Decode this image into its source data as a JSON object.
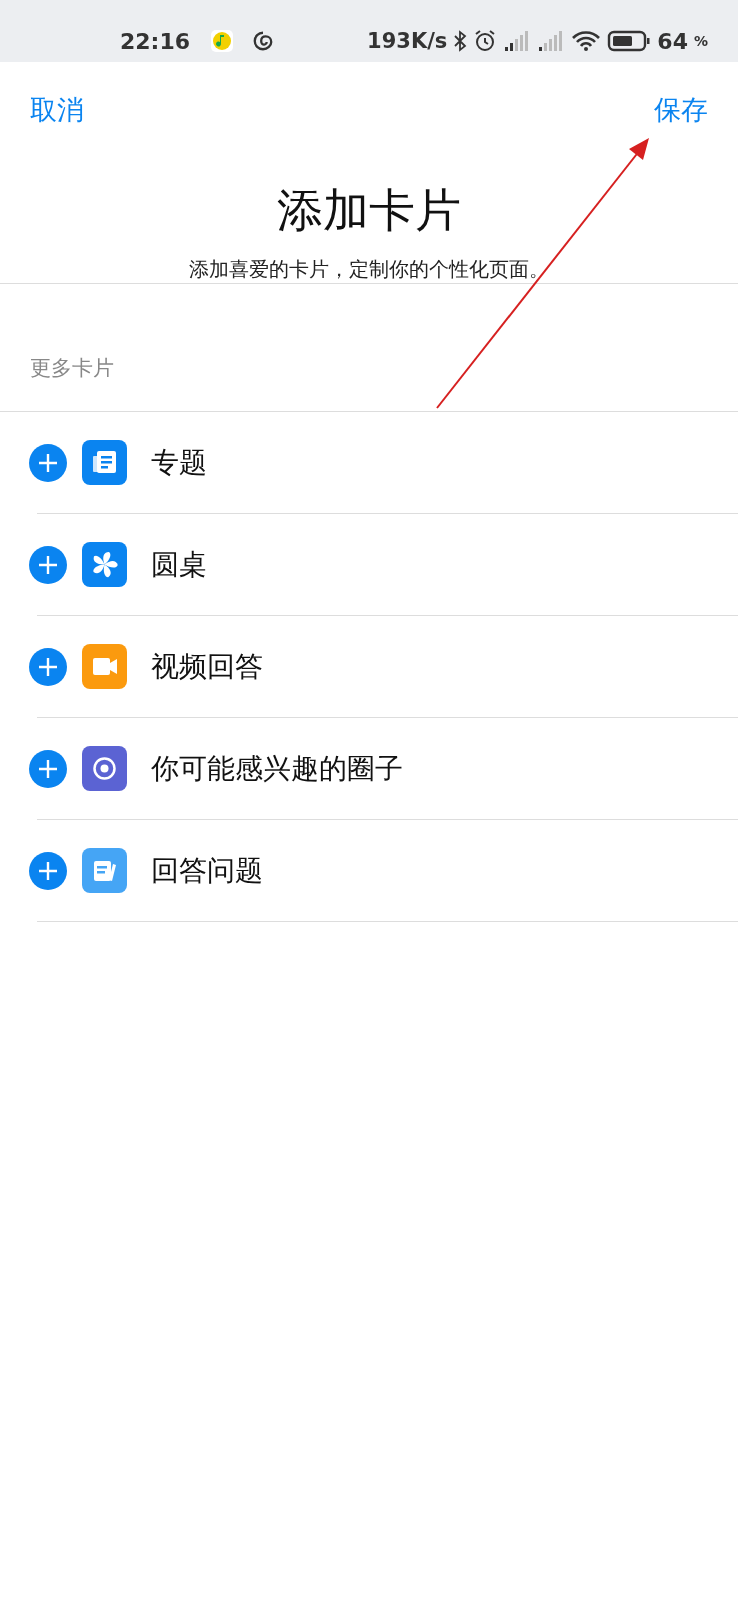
{
  "status_bar": {
    "time": "22:16",
    "speed": "193K/s",
    "battery": "64",
    "battery_unit": "%"
  },
  "nav": {
    "cancel": "取消",
    "save": "保存"
  },
  "header": {
    "title": "添加卡片",
    "subtitle": "添加喜爱的卡片，定制你的个性化页面。"
  },
  "section": {
    "title": "更多卡片"
  },
  "cards": [
    {
      "label": "专题",
      "kind": "document",
      "color": "#0a84f0"
    },
    {
      "label": "圆桌",
      "kind": "pinwheel",
      "color": "#0a84f0"
    },
    {
      "label": "视频回答",
      "kind": "video",
      "color": "#fb9a0e"
    },
    {
      "label": "你可能感兴趣的圈子",
      "kind": "circle",
      "color": "#5b63d3"
    },
    {
      "label": "回答问题",
      "kind": "pen",
      "color": "#45a5f5"
    }
  ]
}
